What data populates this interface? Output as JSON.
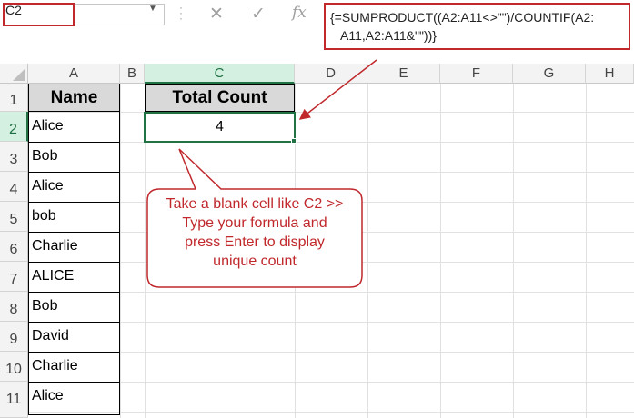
{
  "namebox": {
    "value": "C2"
  },
  "formula_bar": {
    "cancel_icon": "✕",
    "enter_icon": "✓",
    "fx_icon": "fx",
    "formula_line1": "{=SUMPRODUCT((A2:A11<>\"\")/COUNTIF(A2:",
    "formula_line2": "A11,A2:A11&\"\"))}"
  },
  "columns": [
    "A",
    "B",
    "C",
    "D",
    "E",
    "F",
    "G",
    "H"
  ],
  "rows": [
    "1",
    "2",
    "3",
    "4",
    "5",
    "6",
    "7",
    "8",
    "9",
    "10",
    "11"
  ],
  "sheet": {
    "a1": "Name",
    "names": [
      "Alice",
      "Bob",
      "Alice",
      "bob",
      "Charlie",
      "ALICE",
      "Bob",
      "David",
      "Charlie",
      "Alice"
    ],
    "c1": "Total Count",
    "c2": "4"
  },
  "callout": {
    "text": "Take a blank cell like C2 >> Type your formula and press Enter to display unique count",
    "line1": "Take a blank cell like C2 >>",
    "line2": "Type your formula and",
    "line3": "press Enter to display",
    "line4": "unique count",
    "color": "#c0282c"
  },
  "colors": {
    "selection": "#217346",
    "header_fill": "#d9d9d9",
    "annotation": "#c0282c"
  }
}
